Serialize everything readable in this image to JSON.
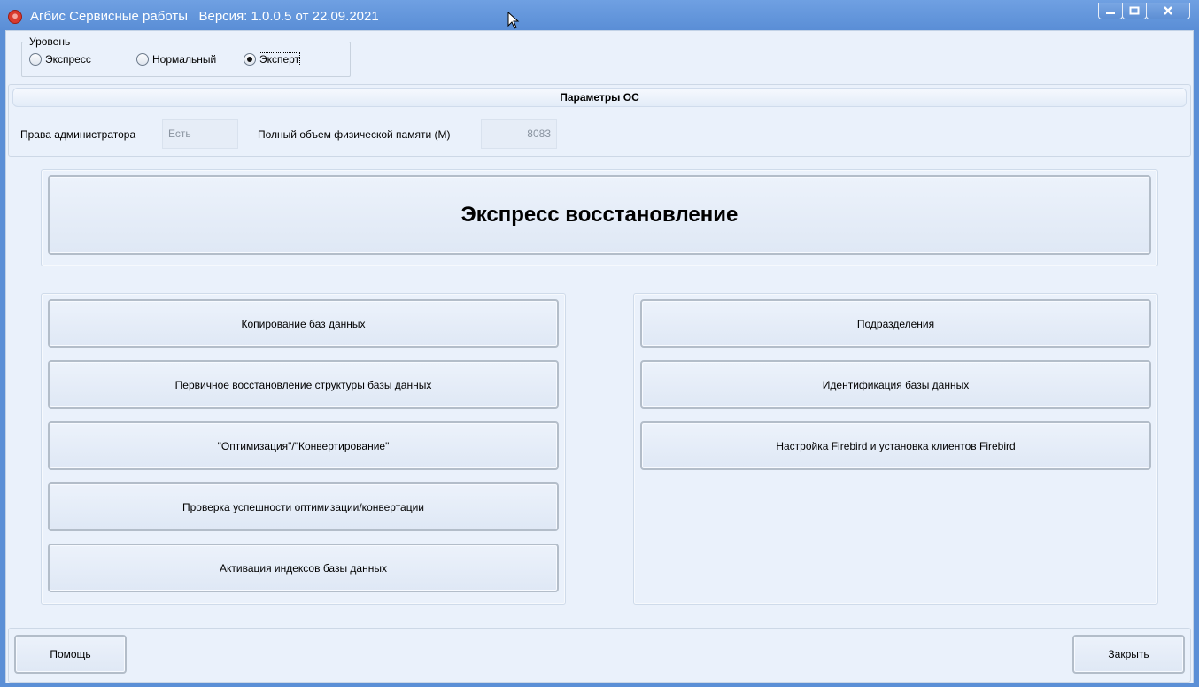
{
  "window": {
    "title": "Агбис Сервисные работы   Версия: 1.0.0.5 от 22.09.2021",
    "minimize": "—",
    "maximize": "☐",
    "close": "✕"
  },
  "level": {
    "legend": "Уровень",
    "options": [
      {
        "label": "Экспресс",
        "checked": false
      },
      {
        "label": "Нормальный",
        "checked": false
      },
      {
        "label": "Эксперт",
        "checked": true
      }
    ]
  },
  "os_params": {
    "header": "Параметры ОС",
    "admin_label": "Права администратора",
    "admin_value": "Есть",
    "memory_label": "Полный объем физической памяти (M)",
    "memory_value": "8083"
  },
  "express_button": "Экспресс восстановление",
  "left_buttons": [
    "Копирование баз данных",
    "Первичное восстановление структуры базы данных",
    "\"Оптимизация\"/\"Конвертирование\"",
    "Проверка успешности оптимизации/конвертации",
    "Активация индексов базы данных"
  ],
  "right_buttons": [
    "Подразделения",
    "Идентификация базы данных",
    "Настройка Firebird и установка клиентов Firebird"
  ],
  "footer": {
    "help": "Помощь",
    "close": "Закрыть"
  }
}
